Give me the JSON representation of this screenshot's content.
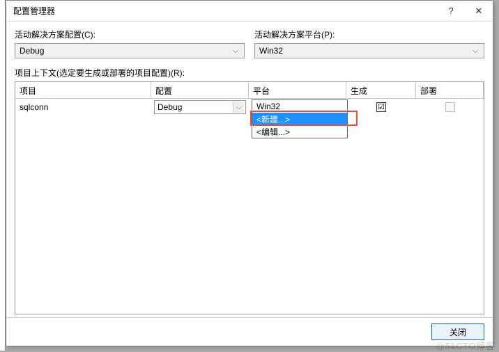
{
  "window": {
    "title": "配置管理器",
    "help_icon": "?",
    "close_icon": "✕"
  },
  "topRow": {
    "config_label": "活动解决方案配置(C):",
    "config_value": "Debug",
    "platform_label": "活动解决方案平台(P):",
    "platform_value": "Win32"
  },
  "contextLabel": "项目上下文(选定要生成或部署的项目配置)(R):",
  "gridHeaders": {
    "project": "项目",
    "config": "配置",
    "platform": "平台",
    "build": "生成",
    "deploy": "部署"
  },
  "row": {
    "project": "sqlconn",
    "config": "Debug",
    "platform": "Win32",
    "build_checked": "☑",
    "deploy_checked": ""
  },
  "dropdown": {
    "opts": [
      "Win32",
      "<新建...>",
      "<编辑...>"
    ]
  },
  "footer": {
    "close": "关闭"
  },
  "watermark": "@51CTO博客"
}
